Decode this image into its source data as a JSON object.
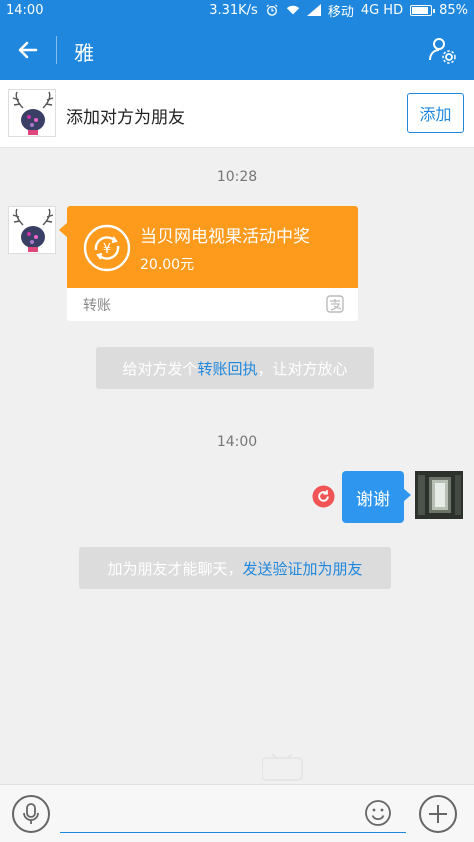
{
  "status_bar": {
    "time": "14:00",
    "speed": "3.31K/s",
    "carrier": "移动",
    "network": "4G HD",
    "battery": "85%"
  },
  "header": {
    "title": "雅",
    "back_icon": "arrow-left-icon",
    "profile_icon": "user-settings-icon"
  },
  "add_friend_bar": {
    "text": "添加对方为朋友",
    "button_label": "添加"
  },
  "messages": {
    "time_1": "10:28",
    "transfer": {
      "title": "当贝网电视果活动中奖",
      "amount": "20.00元",
      "label": "转账",
      "icon": "yen-exchange-icon"
    },
    "notice_1": {
      "prefix": "给对方发个",
      "link": "转账回执",
      "suffix": "，让对方放心"
    },
    "time_2": "14:00",
    "my_message": "谢谢",
    "notice_2": {
      "prefix": "加为朋友才能聊天，",
      "link": "发送验证加为朋友"
    }
  },
  "input_bar": {
    "placeholder": "",
    "voice_icon": "microphone-icon",
    "emoji_icon": "smiley-icon",
    "plus_icon": "plus-icon"
  },
  "colors": {
    "brand_blue": "#1f88de",
    "transfer_orange": "#fe9a1c",
    "bubble_blue": "#2f96f0",
    "error_red": "#f05454"
  }
}
